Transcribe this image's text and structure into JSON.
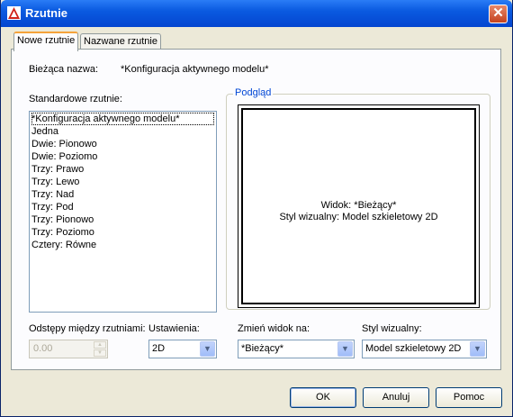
{
  "window": {
    "title": "Rzutnie",
    "close_glyph": "✕"
  },
  "tabs": [
    {
      "label": "Nowe rzutnie",
      "active": true
    },
    {
      "label": "Nazwane rzutnie",
      "active": false
    }
  ],
  "current_name": {
    "label": "Bieżąca nazwa:",
    "value": "*Konfiguracja aktywnego modelu*"
  },
  "standard_viewports": {
    "label": "Standardowe rzutnie:",
    "items": [
      "*Konfiguracja aktywnego modelu*",
      "Jedna",
      "Dwie: Pionowo",
      "Dwie: Poziomo",
      "Trzy: Prawo",
      "Trzy: Lewo",
      "Trzy: Nad",
      "Trzy: Pod",
      "Trzy: Pionowo",
      "Trzy: Poziomo",
      "Cztery: Równe"
    ],
    "selected_index": 0
  },
  "preview": {
    "label": "Podgląd",
    "line1": "Widok: *Bieżący*",
    "line2": "Styl wizualny: Model szkieletowy 2D"
  },
  "spacing": {
    "label": "Odstępy między rzutniami:",
    "value": "0.00"
  },
  "setup": {
    "label": "Ustawienia:",
    "value": "2D"
  },
  "change_view": {
    "label": "Zmień widok na:",
    "value": "*Bieżący*"
  },
  "visual_style": {
    "label": "Styl wizualny:",
    "value": "Model szkieletowy 2D"
  },
  "buttons": {
    "ok": "OK",
    "cancel": "Anuluj",
    "help": "Pomoc"
  },
  "colors": {
    "titlebar": "#0a5ae0",
    "legend": "#0046d5",
    "tab_highlight": "#f5a33b"
  }
}
